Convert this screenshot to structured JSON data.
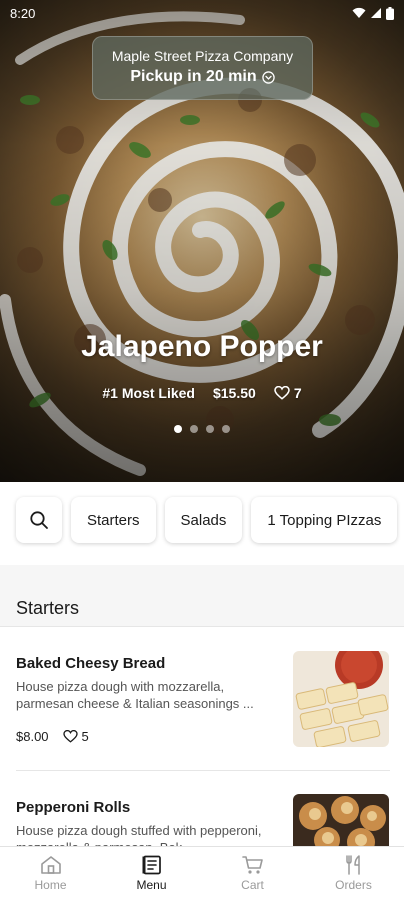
{
  "status_bar": {
    "time": "8:20"
  },
  "store": {
    "name": "Maple Street Pizza Company",
    "pickup": "Pickup in 20 min"
  },
  "featured": {
    "title": "Jalapeno Popper",
    "badge": "#1 Most Liked",
    "price": "$15.50",
    "likes": "7",
    "slide_count": 4,
    "active_slide": 1
  },
  "categories": [
    "Starters",
    "Salads",
    "1 Topping PIzzas"
  ],
  "section": {
    "title": "Starters"
  },
  "items": [
    {
      "name": "Baked Cheesy Bread",
      "description": "House pizza dough with mozzarella, parmesan cheese & Italian seasonings ...",
      "price": "$8.00",
      "likes": "5"
    },
    {
      "name": "Pepperoni Rolls",
      "description": "House pizza dough stuffed with pepperoni, mozzarella & parmesan. Bak..."
    }
  ],
  "nav": [
    {
      "label": "Home",
      "icon": "home-icon"
    },
    {
      "label": "Menu",
      "icon": "menu-icon",
      "active": true
    },
    {
      "label": "Cart",
      "icon": "cart-icon"
    },
    {
      "label": "Orders",
      "icon": "orders-icon"
    }
  ],
  "colors": {
    "text": "#1b1b1b",
    "muted": "#9a9a9a",
    "pill": "#5f695f"
  }
}
